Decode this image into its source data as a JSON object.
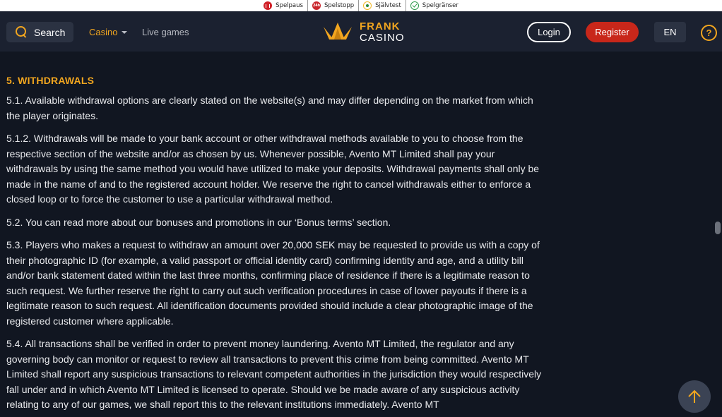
{
  "regulatory_bar": {
    "items": [
      {
        "label": "Spelpaus",
        "icon": "pause-icon"
      },
      {
        "label": "Spelstopp",
        "icon": "24h-icon",
        "icon_text": "24h"
      },
      {
        "label": "Självtest",
        "icon": "self-test-icon"
      },
      {
        "label": "Spelgränser",
        "icon": "check-icon"
      }
    ]
  },
  "header": {
    "search_label": "Search",
    "nav": {
      "casino": "Casino",
      "live_games": "Live games"
    },
    "logo": {
      "top": "FRANK",
      "bottom": "CASINO"
    },
    "login_label": "Login",
    "register_label": "Register",
    "language": "EN",
    "help_symbol": "?"
  },
  "colors": {
    "accent": "#f2a61f",
    "register": "#c8271a",
    "background": "#111621",
    "header": "#1b2130"
  },
  "content": {
    "section_title": "5. WITHDRAWALS",
    "paragraphs": [
      "5.1. Available withdrawal options are clearly stated on the website(s) and may differ depending on the market from which the player originates.",
      "5.1.2. Withdrawals will be made to your bank account or other withdrawal methods available to you to choose from the respective section of the website and/or as chosen by us. Whenever possible, Avento MT Limited shall pay your withdrawals by using the same method you would have utilized to make your deposits. Withdrawal payments shall only be made in the name of and to the registered account holder. We reserve the right to cancel withdrawals either to enforce a closed loop or to force the customer to use a particular withdrawal method.",
      "5.2. You can read more about our bonuses and promotions in our ‘Bonus terms’ section.",
      "5.3. Players who makes a request to withdraw an amount over 20,000 SEK may be requested to provide us with a copy of their photographic ID (for example, a valid passport or official identity card) confirming identity and age, and a utility bill and/or bank statement dated within the last three months, confirming place of residence if there is a legitimate reason to such request. We further reserve the right to carry out such verification procedures in case of lower payouts if there is a legitimate reason to such request. All identification documents provided should include a clear photographic image of the registered customer where applicable.",
      "5.4. All transactions shall be verified in order to prevent money laundering. Avento MT Limited, the regulator and any governing body can monitor or request to review all transactions to prevent this crime from being committed. Avento MT Limited shall report any suspicious transactions to relevant competent authorities in the jurisdiction they would respectively fall under and in which Avento MT Limited is licensed to operate. Should we be made aware of any suspicious activity relating to any of our games, we shall report this to the relevant institutions immediately. Avento MT"
    ]
  }
}
